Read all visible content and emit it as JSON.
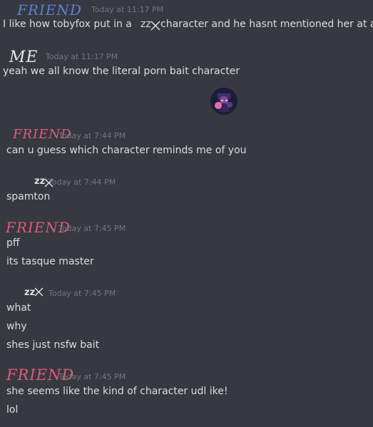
{
  "colors": {
    "background": "#36393f",
    "text": "#dcddde",
    "timestamp": "#72767d",
    "friend_blue": "#5b7fd1",
    "friend_red": "#e05a7c",
    "me_white": "#e6e6e6"
  },
  "messages": [
    {
      "author": "FRIEND",
      "author_style": "handwritten-blue",
      "timestamp": "Today at 11:17 PM",
      "lines": [
        {
          "before": "I like how tobyfox put in a",
          "name": "zz",
          "after": "character and he hasnt mentioned her at all"
        }
      ]
    },
    {
      "author": "ME",
      "author_style": "handwritten-white",
      "timestamp": "Today at 11:17 PM",
      "lines": [
        {
          "text": "yeah we all know the literal porn bait character"
        }
      ]
    },
    {
      "author": "FRIEND",
      "author_style": "handwritten-red",
      "timestamp": "Today at 7:44 PM",
      "lines": [
        {
          "text": "can u guess which character reminds me of you"
        }
      ]
    },
    {
      "author": "zz",
      "author_style": "handle-with-cross",
      "timestamp": "Today at 7:44 PM",
      "lines": [
        {
          "text": "spamton"
        }
      ]
    },
    {
      "author": "FRIEND",
      "author_style": "handwritten-red",
      "timestamp": "Today at 7:45 PM",
      "lines": [
        {
          "text": "pff"
        },
        {
          "text": "its tasque master"
        }
      ]
    },
    {
      "author": "zz",
      "author_style": "handle-with-cross",
      "timestamp": "Today at 7:45 PM",
      "lines": [
        {
          "text": "what"
        },
        {
          "text": "why"
        },
        {
          "text": "shes just nsfw bait"
        }
      ]
    },
    {
      "author": "FRIEND",
      "author_style": "handwritten-red",
      "timestamp": "Today at 7:45 PM",
      "lines": [
        {
          "text": "she seems like the kind of character udl ike!"
        },
        {
          "text": "lol"
        }
      ]
    }
  ],
  "avatar_icon": "character-avatar-icon",
  "redaction_icon": "cross-scribble-icon"
}
